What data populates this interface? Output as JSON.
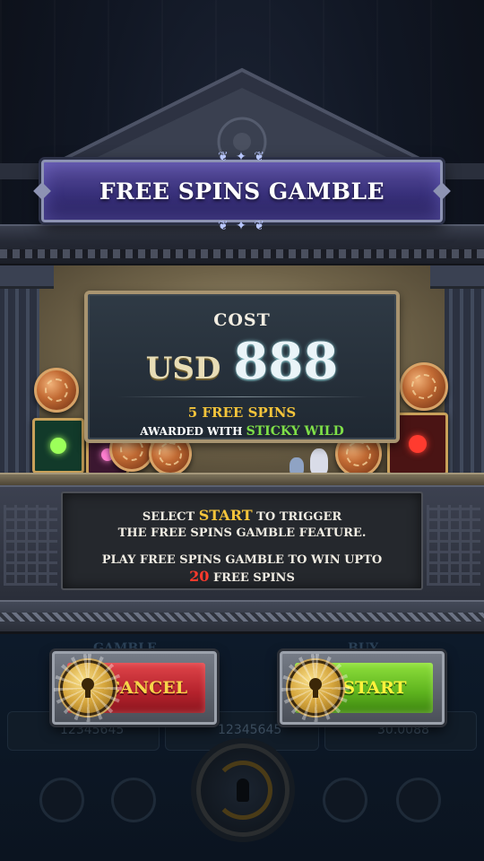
{
  "dialog": {
    "title": "FREE SPINS GAMBLE",
    "cost_label": "COST",
    "currency": "USD",
    "amount": "888",
    "free_spins": "5 FREE SPINS",
    "awarded_prefix": "AWARDED WITH",
    "awarded_feature": "STICKY WILD"
  },
  "description": {
    "line1_prefix": "SELECT",
    "line1_highlight": "START",
    "line1_suffix": "TO TRIGGER",
    "line2": "THE FREE SPINS GAMBLE FEATURE.",
    "line3": "PLAY FREE SPINS GAMBLE TO WIN UPTO",
    "line4_highlight": "20",
    "line4_suffix": "FREE SPINS"
  },
  "buttons": {
    "cancel": "CANCEL",
    "start": "START"
  },
  "background_ui": {
    "gamble_tab": "GAMBLE",
    "buy_tab": "BUY",
    "balance": "12345645",
    "bet": "12345645",
    "win": "30.0088"
  },
  "colors": {
    "title_banner": "#38307a",
    "cancel": "#b4222c",
    "start": "#5db21e",
    "highlight_gold": "#f4c43b",
    "highlight_red": "#ff3a2c",
    "sticky_green": "#7fe048"
  },
  "icons": [
    "lock-keyhole-icon",
    "laurel-icon",
    "spin-icon",
    "wallet-icon",
    "coins-icon",
    "trophy-icon",
    "lightning-icon",
    "minus-icon",
    "plus-icon",
    "autoplay-icon"
  ]
}
